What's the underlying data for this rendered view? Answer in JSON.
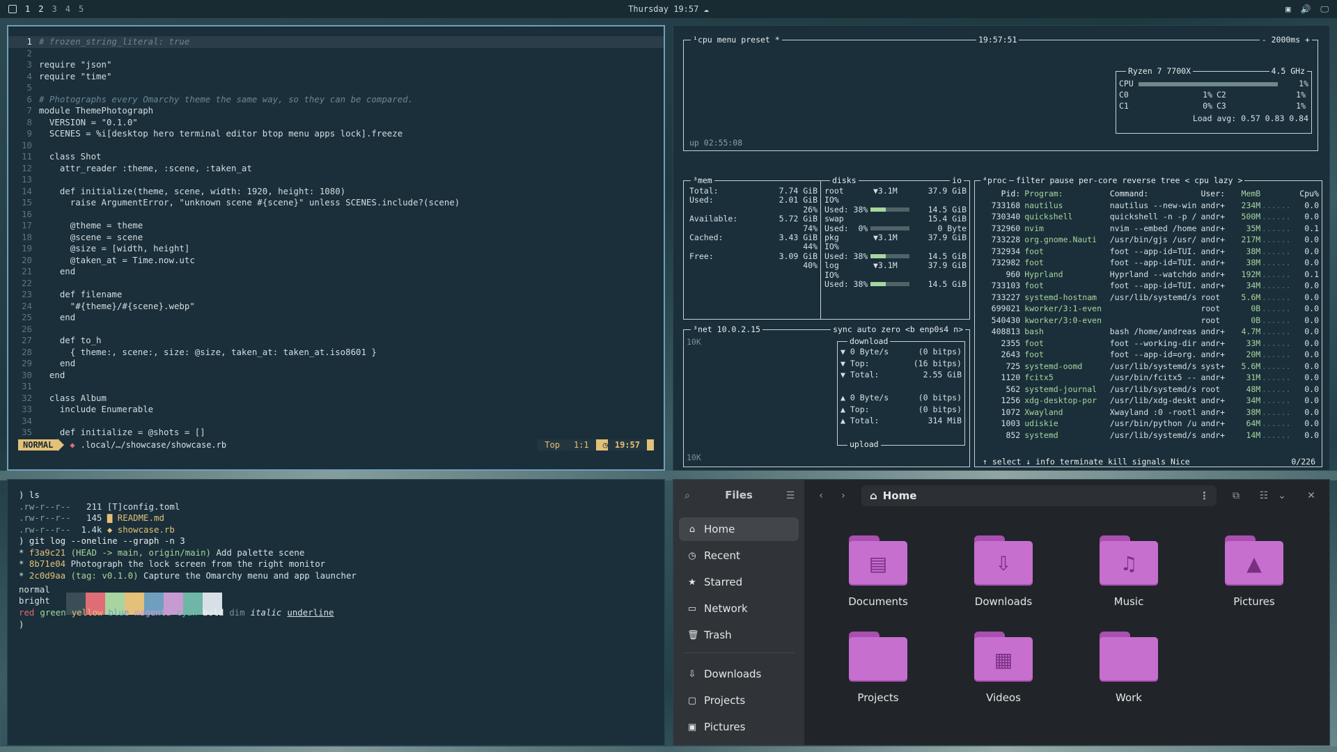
{
  "topbar": {
    "workspaces": [
      "1",
      "2",
      "3",
      "4",
      "5"
    ],
    "clock": "Thursday 19:57"
  },
  "editor": {
    "lines": [
      {
        "n": "1",
        "t": "# frozen_string_literal: true"
      },
      {
        "n": "2",
        "t": ""
      },
      {
        "n": "3",
        "t": "require \"json\""
      },
      {
        "n": "4",
        "t": "require \"time\""
      },
      {
        "n": "5",
        "t": ""
      },
      {
        "n": "6",
        "t": "# Photographs every Omarchy theme the same way, so they can be compared."
      },
      {
        "n": "7",
        "t": "module ThemePhotograph"
      },
      {
        "n": "8",
        "t": "  VERSION = \"0.1.0\""
      },
      {
        "n": "9",
        "t": "  SCENES = %i[desktop hero terminal editor btop menu apps lock].freeze"
      },
      {
        "n": "10",
        "t": ""
      },
      {
        "n": "11",
        "t": "  class Shot"
      },
      {
        "n": "12",
        "t": "    attr_reader :theme, :scene, :taken_at"
      },
      {
        "n": "13",
        "t": ""
      },
      {
        "n": "14",
        "t": "    def initialize(theme, scene, width: 1920, height: 1080)"
      },
      {
        "n": "15",
        "t": "      raise ArgumentError, \"unknown scene #{scene}\" unless SCENES.include?(scene)"
      },
      {
        "n": "16",
        "t": ""
      },
      {
        "n": "17",
        "t": "      @theme = theme"
      },
      {
        "n": "18",
        "t": "      @scene = scene"
      },
      {
        "n": "19",
        "t": "      @size = [width, height]"
      },
      {
        "n": "20",
        "t": "      @taken_at = Time.now.utc"
      },
      {
        "n": "21",
        "t": "    end"
      },
      {
        "n": "22",
        "t": ""
      },
      {
        "n": "23",
        "t": "    def filename"
      },
      {
        "n": "24",
        "t": "      \"#{theme}/#{scene}.webp\""
      },
      {
        "n": "25",
        "t": "    end"
      },
      {
        "n": "26",
        "t": ""
      },
      {
        "n": "27",
        "t": "    def to_h"
      },
      {
        "n": "28",
        "t": "      { theme:, scene:, size: @size, taken_at: taken_at.iso8601 }"
      },
      {
        "n": "29",
        "t": "    end"
      },
      {
        "n": "30",
        "t": "  end"
      },
      {
        "n": "31",
        "t": ""
      },
      {
        "n": "32",
        "t": "  class Album"
      },
      {
        "n": "33",
        "t": "    include Enumerable"
      },
      {
        "n": "34",
        "t": ""
      },
      {
        "n": "35",
        "t": "    def initialize = @shots = []"
      }
    ],
    "status": {
      "mode": "NORMAL",
      "file": ".local/…/showcase/showcase.rb",
      "position": "Top",
      "cursor": "1:1",
      "time": "19:57"
    }
  },
  "btop": {
    "cpu_title": "cpu",
    "menu": "menu",
    "preset": "preset *",
    "clock": "19:57:51",
    "interval": "- 2000ms +",
    "uptime": "up 02:55:08",
    "cpu_model": "Ryzen 7 7700X",
    "cpu_freq": "4.5 GHz",
    "cpu_rows": [
      {
        "label": "CPU",
        "pct": "1%"
      },
      {
        "label": "C0",
        "pct": "1%",
        "label2": "C2",
        "pct2": "1%"
      },
      {
        "label": "C1",
        "pct": "0%",
        "label2": "C3",
        "pct2": "1%"
      }
    ],
    "load_avg": "Load avg: 0.57 0.83 0.84",
    "mem": {
      "title": "mem",
      "rows": [
        {
          "k": "Total:",
          "v": "7.74 GiB"
        },
        {
          "k": "Used:",
          "v": "2.01 GiB"
        },
        {
          "k": "",
          "v": "26%"
        },
        {
          "k": "Available:",
          "v": "5.72 GiB"
        },
        {
          "k": "",
          "v": "74%"
        },
        {
          "k": "Cached:",
          "v": "3.43 GiB"
        },
        {
          "k": "",
          "v": "44%"
        },
        {
          "k": "Free:",
          "v": "3.09 GiB"
        },
        {
          "k": "",
          "v": "40%"
        }
      ]
    },
    "disks": {
      "title": "disks",
      "io": "io",
      "rows": [
        {
          "name": "root",
          "io": "▼3.1M",
          "size": "37.9 GiB"
        },
        {
          "name": "IO%",
          "io": "",
          "size": ""
        },
        {
          "name": "Used: 38%",
          "io": "",
          "size": "14.5 GiB",
          "fill": 0.38
        },
        {
          "name": "swap",
          "io": "",
          "size": "15.4 GiB"
        },
        {
          "name": "Used:  0%",
          "io": "",
          "size": "0 Byte",
          "fill": 0.0
        },
        {
          "name": "pkg",
          "io": "▼3.1M",
          "size": "37.9 GiB"
        },
        {
          "name": "IO%",
          "io": "",
          "size": ""
        },
        {
          "name": "Used: 38%",
          "io": "",
          "size": "14.5 GiB",
          "fill": 0.38
        },
        {
          "name": "log",
          "io": "▼3.1M",
          "size": "37.9 GiB"
        },
        {
          "name": "IO%",
          "io": "",
          "size": ""
        },
        {
          "name": "Used: 38%",
          "io": "",
          "size": "14.5 GiB",
          "fill": 0.38
        }
      ]
    },
    "net": {
      "title": "net",
      "ip": "10.0.2.15",
      "controls": "sync auto zero <b enp0s4 n>",
      "scale_top": "10K",
      "scale_bottom": "10K",
      "download": "download",
      "upload": "upload",
      "down_rows": [
        {
          "k": "▼ 0 Byte/s",
          "v": "(0 bitps)"
        },
        {
          "k": "▼ Top:",
          "v": "(16 bitps)"
        },
        {
          "k": "▼ Total:",
          "v": "2.55 GiB"
        }
      ],
      "up_rows": [
        {
          "k": "▲ 0 Byte/s",
          "v": "(0 bitps)"
        },
        {
          "k": "▲ Top:",
          "v": "(0 bitps)"
        },
        {
          "k": "▲ Total:",
          "v": "314 MiB"
        }
      ]
    },
    "proc": {
      "title": "proc",
      "controls": "filter  pause per-core reverse tree < cpu lazy >",
      "headers": [
        "Pid:",
        "Program:",
        "Command:",
        "User:",
        "MemB",
        "",
        "Cpu%"
      ],
      "rows": [
        [
          "733168",
          "nautilus",
          "nautilus --new-win",
          "andr+",
          "234M",
          "0.0"
        ],
        [
          "730340",
          "quickshell",
          "quickshell -n -p /",
          "andr+",
          "500M",
          "0.0"
        ],
        [
          "732960",
          "nvim",
          "nvim --embed /home",
          "andr+",
          "35M",
          "0.1"
        ],
        [
          "733228",
          "org.gnome.Nauti",
          "/usr/bin/gjs /usr/",
          "andr+",
          "217M",
          "0.0"
        ],
        [
          "732934",
          "foot",
          "foot --app-id=TUI.",
          "andr+",
          "38M",
          "0.0"
        ],
        [
          "732982",
          "foot",
          "foot --app-id=TUI.",
          "andr+",
          "38M",
          "0.0"
        ],
        [
          "960",
          "Hyprland",
          "Hyprland --watchdo",
          "andr+",
          "192M",
          "0.1"
        ],
        [
          "733103",
          "foot",
          "foot --app-id=TUI.",
          "andr+",
          "34M",
          "0.0"
        ],
        [
          "733227",
          "systemd-hostnam",
          "/usr/lib/systemd/s",
          "root",
          "5.6M",
          "0.0"
        ],
        [
          "699021",
          "kworker/3:1-even",
          "",
          "root",
          "0B",
          "0.0"
        ],
        [
          "540430",
          "kworker/3:0-even",
          "",
          "root",
          "0B",
          "0.0"
        ],
        [
          "408813",
          "bash",
          "bash /home/andreas",
          "andr+",
          "4.7M",
          "0.0"
        ],
        [
          "2355",
          "foot",
          "foot --working-dir",
          "andr+",
          "33M",
          "0.0"
        ],
        [
          "2643",
          "foot",
          "foot --app-id=org.",
          "andr+",
          "20M",
          "0.0"
        ],
        [
          "725",
          "systemd-oomd",
          "/usr/lib/systemd/s",
          "syst+",
          "5.6M",
          "0.0"
        ],
        [
          "1120",
          "fcitx5",
          "/usr/bin/fcitx5 --",
          "andr+",
          "31M",
          "0.0"
        ],
        [
          "562",
          "systemd-journal",
          "/usr/lib/systemd/s",
          "root",
          "48M",
          "0.0"
        ],
        [
          "1256",
          "xdg-desktop-por",
          "/usr/lib/xdg-deskt",
          "andr+",
          "34M",
          "0.0"
        ],
        [
          "1072",
          "Xwayland",
          "Xwayland :0 -rootl",
          "andr+",
          "38M",
          "0.0"
        ],
        [
          "1003",
          "udiskie",
          "/usr/bin/python /u",
          "andr+",
          "64M",
          "0.0"
        ],
        [
          "852",
          "systemd",
          "/usr/lib/systemd/s",
          "andr+",
          "14M",
          "0.0"
        ]
      ],
      "footer": "↑ select ↓ info  terminate  kill  signals  Nice",
      "count": "0/226"
    }
  },
  "terminal": {
    "lines": [
      {
        "seg": [
          {
            "t": ") ls",
            "c": "#e6edf0"
          }
        ]
      },
      {
        "seg": [
          {
            "t": ".rw-r--r--  ",
            "c": "#8aa0a8"
          },
          {
            "t": " 211 ",
            "c": "#d6e0e6"
          },
          {
            "t": "[T]config.toml",
            "c": "#d6e0e6"
          }
        ]
      },
      {
        "seg": [
          {
            "t": ".rw-r--r--  ",
            "c": "#8aa0a8"
          },
          {
            "t": " 145 ",
            "c": "#d6e0e6"
          },
          {
            "t": "▇ README.md",
            "c": "#e3c179"
          }
        ]
      },
      {
        "seg": [
          {
            "t": ".rw-r--r--  ",
            "c": "#8aa0a8"
          },
          {
            "t": "1.4k ",
            "c": "#d6e0e6"
          },
          {
            "t": "◆ showcase.rb",
            "c": "#e3c179"
          }
        ]
      },
      {
        "seg": [
          {
            "t": ") git log --oneline --graph -n 3",
            "c": "#e6edf0"
          }
        ]
      },
      {
        "seg": [
          {
            "t": "* ",
            "c": "#d6e0e6"
          },
          {
            "t": "f3a9c21",
            "c": "#e3c179"
          },
          {
            "t": " (HEAD -> main, origin/main)",
            "c": "#a8d59f"
          },
          {
            "t": " Add palette scene",
            "c": "#d6e0e6"
          }
        ]
      },
      {
        "seg": [
          {
            "t": "* ",
            "c": "#d6e0e6"
          },
          {
            "t": "8b71e04",
            "c": "#e3c179"
          },
          {
            "t": " Photograph the lock screen from the right monitor",
            "c": "#d6e0e6"
          }
        ]
      },
      {
        "seg": [
          {
            "t": "* ",
            "c": "#d6e0e6"
          },
          {
            "t": "2c0d9aa",
            "c": "#e3c179"
          },
          {
            "t": " (tag: v0.1.0)",
            "c": "#a8d59f"
          },
          {
            "t": " Capture the Omarchy menu and app launcher",
            "c": "#d6e0e6"
          }
        ]
      }
    ],
    "palette_normal_label": "normal",
    "palette_bright_label": "bright",
    "palette_colors": [
      "#3b4d56",
      "#e06c75",
      "#a8d59f",
      "#e3c179",
      "#6f9fbf",
      "#c79bd1",
      "#6fb6a6",
      "#d6e0e6"
    ],
    "style_words": [
      {
        "t": "red",
        "c": "#e06c75"
      },
      {
        "t": "green",
        "c": "#a8d59f"
      },
      {
        "t": "yellow",
        "c": "#e3c179"
      },
      {
        "t": "blue",
        "c": "#6f9fbf"
      },
      {
        "t": "magenta",
        "c": "#c79bd1"
      },
      {
        "t": "cyan",
        "c": "#6fb6a6"
      },
      {
        "t": "bold",
        "c": "#e6edf0"
      },
      {
        "t": "dim",
        "c": "#7c8e96"
      },
      {
        "t": "italic",
        "c": "#d6e0e6"
      },
      {
        "t": "underline",
        "c": "#d6e0e6"
      }
    ],
    "prompt": ")"
  },
  "files": {
    "title": "Files",
    "path": "Home",
    "sidebar": [
      {
        "label": "Home",
        "icon": "⌂",
        "sel": true
      },
      {
        "label": "Recent",
        "icon": "◷"
      },
      {
        "label": "Starred",
        "icon": "★"
      },
      {
        "label": "Network",
        "icon": "▭"
      },
      {
        "label": "Trash",
        "icon": "🗑"
      }
    ],
    "bookmarks": [
      {
        "label": "Downloads",
        "icon": "⇩"
      },
      {
        "label": "Projects",
        "icon": "▢"
      },
      {
        "label": "Pictures",
        "icon": "▣"
      }
    ],
    "folders": [
      {
        "label": "Documents",
        "glyph": "▤"
      },
      {
        "label": "Downloads",
        "glyph": "⇩"
      },
      {
        "label": "Music",
        "glyph": "♫"
      },
      {
        "label": "Pictures",
        "glyph": "▲"
      },
      {
        "label": "Projects",
        "glyph": ""
      },
      {
        "label": "Videos",
        "glyph": "▦"
      },
      {
        "label": "Work",
        "glyph": ""
      }
    ]
  }
}
